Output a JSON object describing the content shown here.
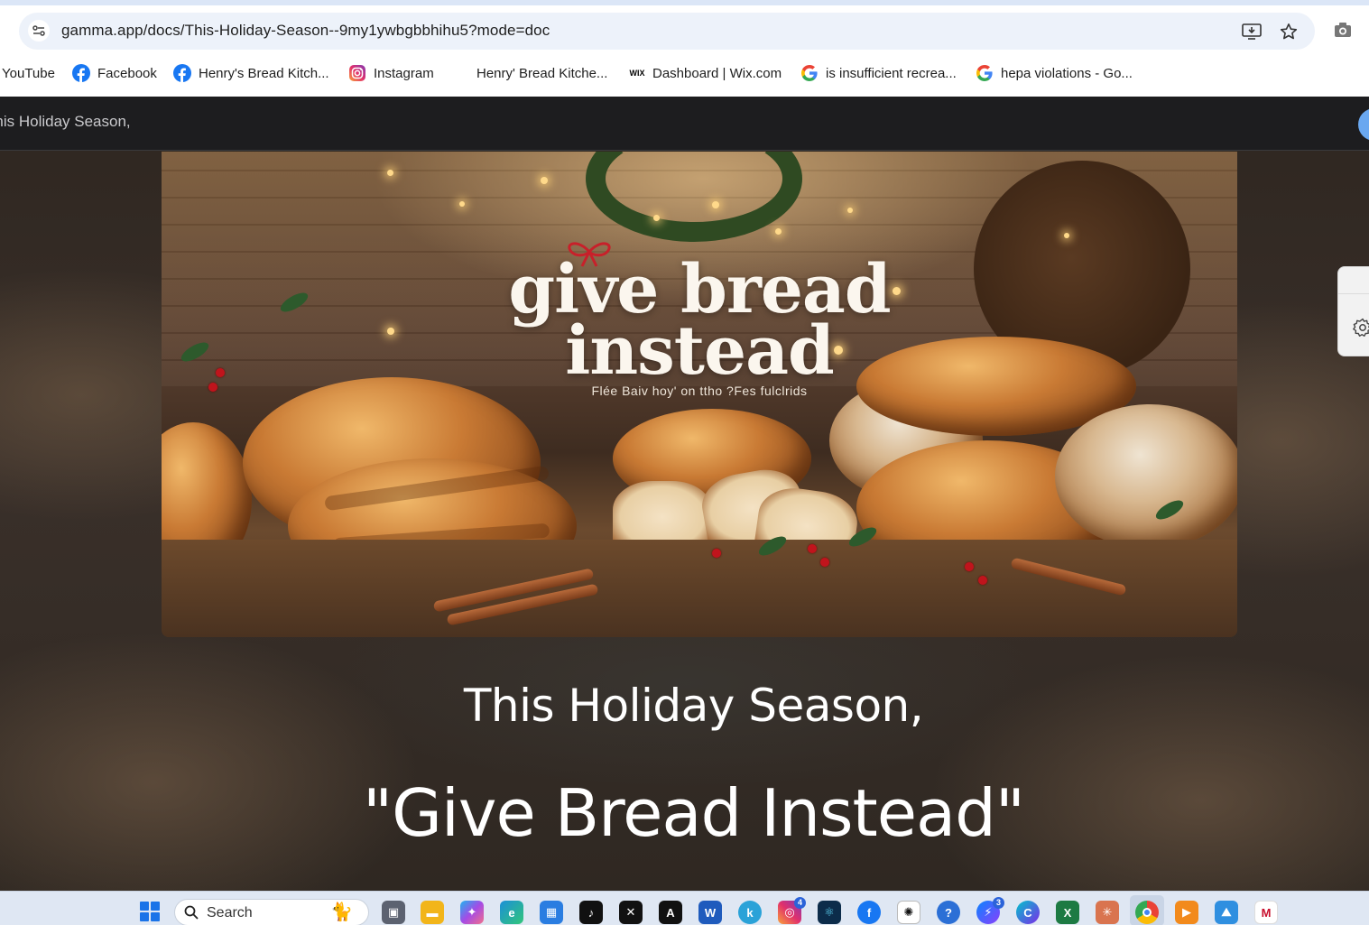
{
  "browser": {
    "url": "gamma.app/docs/This-Holiday-Season--9my1ywbgbbhihu5?mode=doc",
    "bookmarks": [
      {
        "label": "YouTube",
        "icon": "youtube-icon"
      },
      {
        "label": "Facebook",
        "icon": "facebook-icon"
      },
      {
        "label": "Henry's Bread Kitch...",
        "icon": "facebook-icon"
      },
      {
        "label": "Instagram",
        "icon": "instagram-icon"
      },
      {
        "label": "Henry' Bread Kitche...",
        "icon": "blank-page-icon"
      },
      {
        "label": "Dashboard | Wix.com",
        "icon": "wix-icon"
      },
      {
        "label": "is insufficient recrea...",
        "icon": "google-icon"
      },
      {
        "label": "hepa violations - Go...",
        "icon": "google-icon"
      }
    ]
  },
  "doc": {
    "header_title": "This Holiday Season,",
    "hero": {
      "title_line_1": "give bread",
      "title_line_2": "instead",
      "subtitle": "Flée Baiv hoy' on ttho ?Fes fulclrids"
    },
    "heading_1": "This Holiday Season,",
    "heading_2": "\"Give Bread Instead\""
  },
  "taskbar": {
    "search_label": "Search",
    "apps": [
      {
        "name": "task-view",
        "badge": ""
      },
      {
        "name": "file-explorer",
        "badge": ""
      },
      {
        "name": "copilot",
        "badge": ""
      },
      {
        "name": "edge",
        "badge": ""
      },
      {
        "name": "store",
        "badge": ""
      },
      {
        "name": "tiktok",
        "badge": ""
      },
      {
        "name": "capcut",
        "badge": ""
      },
      {
        "name": "ai-app",
        "badge": ""
      },
      {
        "name": "word",
        "badge": ""
      },
      {
        "name": "k-app",
        "badge": ""
      },
      {
        "name": "instagram",
        "badge": "4"
      },
      {
        "name": "react",
        "badge": ""
      },
      {
        "name": "facebook",
        "badge": ""
      },
      {
        "name": "chatgpt",
        "badge": ""
      },
      {
        "name": "help",
        "badge": ""
      },
      {
        "name": "messenger",
        "badge": "3"
      },
      {
        "name": "canva",
        "badge": ""
      },
      {
        "name": "excel",
        "badge": ""
      },
      {
        "name": "claude",
        "badge": ""
      },
      {
        "name": "chrome",
        "badge": ""
      },
      {
        "name": "media-player",
        "badge": ""
      },
      {
        "name": "photos",
        "badge": ""
      },
      {
        "name": "mcafee",
        "badge": ""
      }
    ]
  },
  "colors": {
    "accent_blue": "#1a73e8",
    "page_dark": "#1d1d1f",
    "omnibox_bg": "#edf2fa"
  }
}
